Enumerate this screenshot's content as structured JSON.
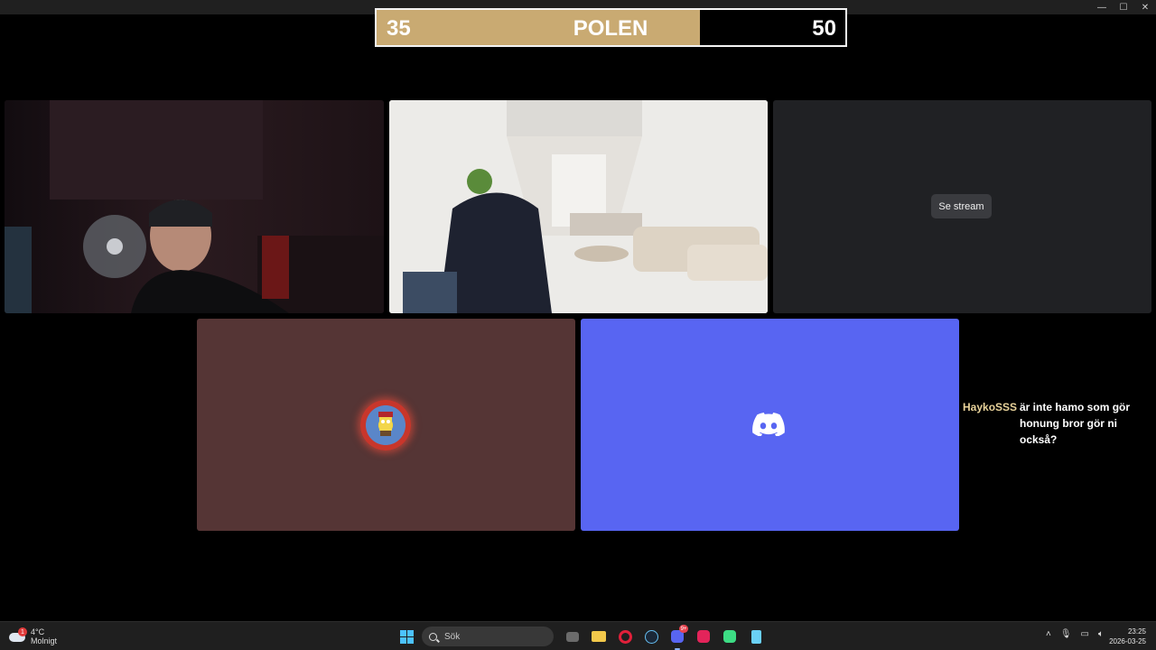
{
  "window": {
    "minimize": "—",
    "maximize": "☐",
    "close": "✕"
  },
  "scoreboard": {
    "left_score": "35",
    "team": "POLEN",
    "right_score": "50",
    "left_color": "#c9aa72",
    "right_color": "#000000",
    "left_fill_fraction": 0.69
  },
  "tiles": {
    "stream_button": "Se stream",
    "avatar_ring_color": "#c8362b",
    "discord_color": "#5865f2",
    "avatar_bg": "#553535"
  },
  "chat": {
    "username": "HaykoSSS",
    "message": "är inte hamo som gör honung bror gör ni också?"
  },
  "taskbar": {
    "weather_temp": "4°C",
    "weather_desc": "Molnigt",
    "weather_badge": "1",
    "search_placeholder": "Sök",
    "discord_badge": "9+",
    "time": "23:25",
    "date": "2026-03-25",
    "apps": [
      "start-icon",
      "task-view-icon",
      "file-explorer-icon",
      "opera-icon",
      "steam-icon",
      "discord-icon",
      "tiktok-icon",
      "android-icon",
      "notepad-icon"
    ]
  }
}
